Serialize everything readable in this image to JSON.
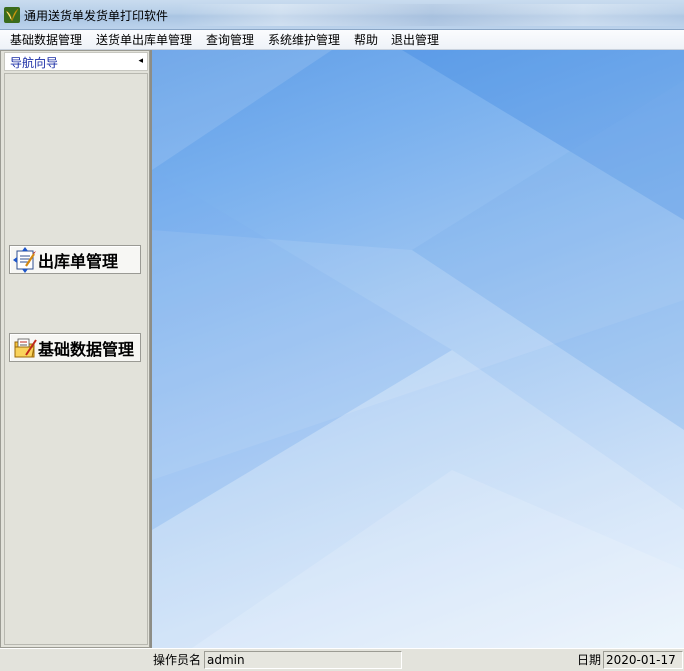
{
  "window": {
    "title": "通用送货单发货单打印软件"
  },
  "menu": [
    {
      "label": "基础数据管理"
    },
    {
      "label": "送货单出库单管理"
    },
    {
      "label": "查询管理"
    },
    {
      "label": "系统维护管理"
    },
    {
      "label": "帮助"
    },
    {
      "label": "退出管理"
    }
  ],
  "nav": {
    "title": "导航向导",
    "collapse_icon": "◂",
    "buttons": [
      {
        "label": "出库单管理",
        "icon": "outbound-document-icon"
      },
      {
        "label": "基础数据管理",
        "icon": "data-folder-icon"
      }
    ]
  },
  "status": {
    "operator_label": "操作员名",
    "operator_value": "admin",
    "date_label": "日期",
    "date_value": "2020-01-17"
  },
  "colors": {
    "nav_title": "#1b2ea6",
    "desktop_top": "#5f9de7",
    "desktop_bottom": "#e6f1fc"
  }
}
